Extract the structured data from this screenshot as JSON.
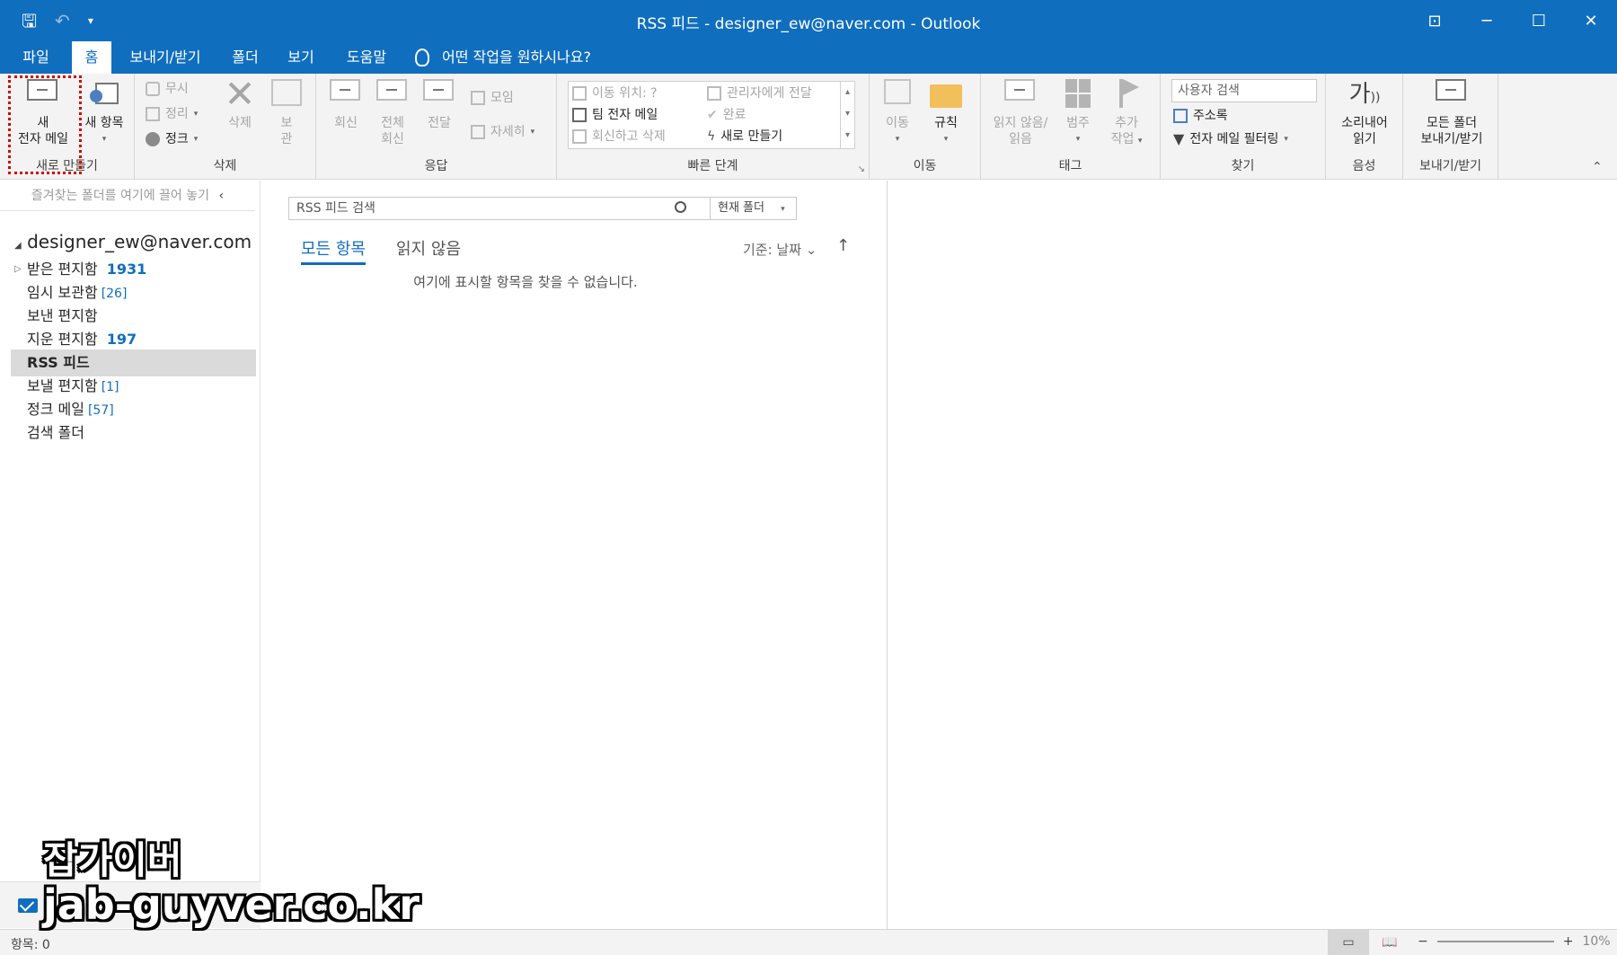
{
  "window": {
    "title": "RSS 피드 - designer_ew@naver.com  -  Outlook",
    "controls": [
      "⊡",
      "─",
      "☐",
      "✕"
    ]
  },
  "quick_access": {
    "save_icon": "save-icon",
    "undo_icon": "undo-icon",
    "more_icon": "customize-qat-icon"
  },
  "tabs": [
    "파일",
    "홈",
    "보내기/받기",
    "폴더",
    "보기",
    "도움말"
  ],
  "active_tab": "홈",
  "tell_me": "어떤 작업을 원하시나요?",
  "ribbon": {
    "new_group": {
      "label": "새로 만들기",
      "new_email_line1": "새",
      "new_email_line2": "전자 메일",
      "new_items": "새 항목"
    },
    "delete_group": {
      "label": "삭제",
      "ignore": "무시",
      "cleanup": "정리",
      "junk": "정크",
      "delete": "삭제",
      "archive_line1": "보",
      "archive_line2": "관"
    },
    "respond_group": {
      "label": "응답",
      "reply": "회신",
      "reply_all_line1": "전체",
      "reply_all_line2": "회신",
      "forward": "전달",
      "meeting": "모임",
      "more": "자세히"
    },
    "quick_steps_group": {
      "label": "빠른 단계",
      "items": [
        "이동 위치: ?",
        "팀 전자 메일",
        "회신하고 삭제",
        "관리자에게 전달",
        "완료",
        "새로 만들기"
      ]
    },
    "move_group": {
      "label": "이동",
      "move": "이동",
      "rules": "규칙"
    },
    "tags_group": {
      "label": "태그",
      "unread_line1": "읽지 않음/",
      "unread_line2": "읽음",
      "categorize": "범주",
      "followup_line1": "추가",
      "followup_line2": "작업"
    },
    "find_group": {
      "label": "찾기",
      "search_people_placeholder": "사용자 검색",
      "address_book": "주소록",
      "filter_email": "전자 메일 필터링"
    },
    "speech_group": {
      "label": "음성",
      "icon_text": "가",
      "read_aloud_line1": "소리내어",
      "read_aloud_line2": "읽기"
    },
    "sendreceive_group": {
      "label": "보내기/받기",
      "all_folders_line1": "모든 폴더",
      "all_folders_line2": "보내기/받기"
    }
  },
  "nav": {
    "favorites_hint": "즐겨찾는 폴더를 여기에 끌어 놓기",
    "account": "designer_ew@naver.com",
    "folders": [
      {
        "name": "받은 편지함",
        "count": "1931",
        "style": "bold",
        "expandable": true
      },
      {
        "name": "임시 보관함",
        "count": "[26]",
        "style": "bracket"
      },
      {
        "name": "보낸 편지함",
        "count": "",
        "style": "none"
      },
      {
        "name": "지운 편지함",
        "count": "197",
        "style": "bold"
      },
      {
        "name": "RSS 피드",
        "count": "",
        "style": "none",
        "selected": true
      },
      {
        "name": "보낼 편지함",
        "count": "[1]",
        "style": "bracket"
      },
      {
        "name": "정크 메일",
        "count": "[57]",
        "style": "bracket"
      },
      {
        "name": "검색 폴더",
        "count": "",
        "style": "none"
      }
    ]
  },
  "list": {
    "search_placeholder": "RSS 피드 검색",
    "scope": "현재 폴더",
    "tabs": [
      "모든 항목",
      "읽지 않음"
    ],
    "sort": "기준: 날짜",
    "sort_arrow": "↑",
    "empty_message": "여기에 표시할 항목을 찾을 수 없습니다."
  },
  "status": {
    "items": "항목: 0",
    "zoom": "10%"
  },
  "watermark": {
    "line1": "잡가이버",
    "line2": "jab-guyver.co.kr"
  },
  "colors": {
    "accent": "#106ebe",
    "ribbon_bg": "#f3f3f3",
    "selected_folder": "#dadada",
    "highlight": "#d40000"
  }
}
